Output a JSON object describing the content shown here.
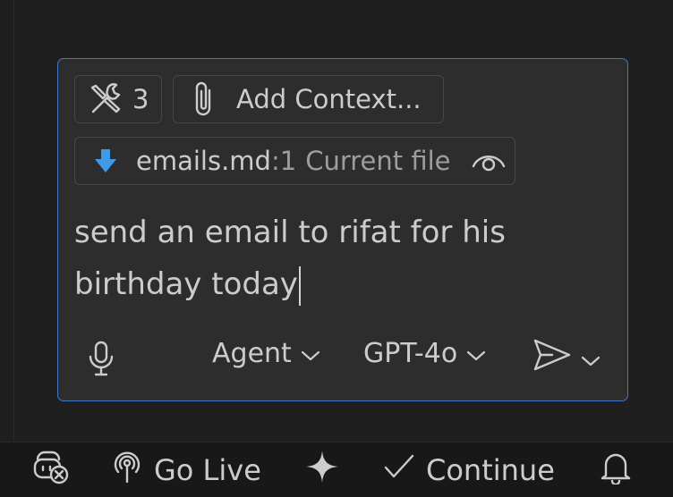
{
  "chat_input": {
    "tools_chip": {
      "count": "3",
      "icon": "tools-icon"
    },
    "add_context_chip": {
      "label": "Add Context...",
      "icon": "paperclip-icon"
    },
    "file_chip": {
      "filename": "emails.md",
      "line": ":1",
      "description": "Current file",
      "icon": "file-arrow-down-icon",
      "preview_icon": "eye-icon"
    },
    "prompt_text": "send an email to rifat for his birthday today",
    "toolbar": {
      "mic_icon": "microphone-icon",
      "mode_label": "Agent",
      "model_label": "GPT-4o",
      "send_icon": "send-icon"
    }
  },
  "status_bar": {
    "go_live_label": "Go Live",
    "continue_label": "Continue"
  },
  "colors": {
    "background": "#1f1f1f",
    "input_background": "#2d2d2d",
    "focus_border": "#3f78c8",
    "chip_border": "#474747",
    "file_icon": "#3d9be9",
    "text": "#cccccc",
    "muted_text": "#9d9d9d"
  }
}
